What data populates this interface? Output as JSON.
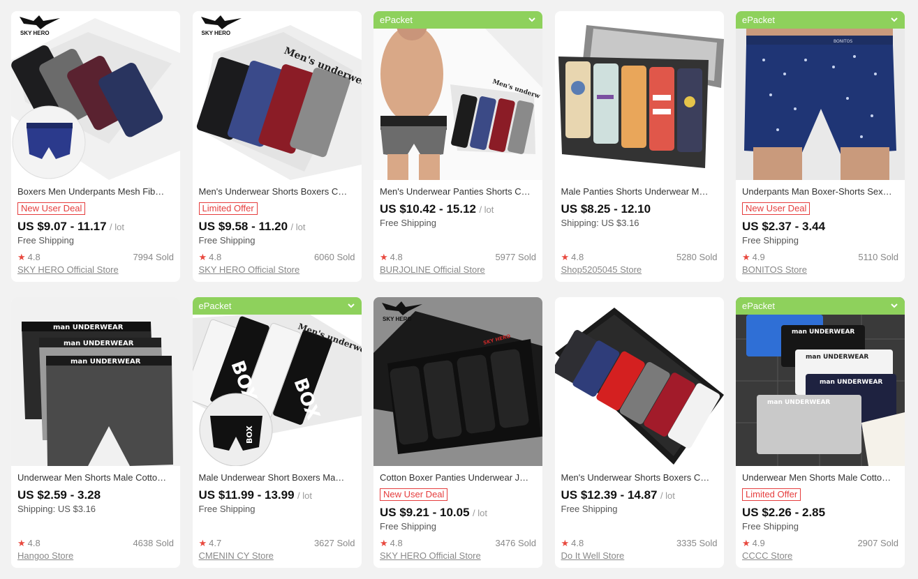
{
  "products": [
    {
      "title": "Boxers Men Underpants Mesh Fib…",
      "tag": "New User Deal",
      "price": "US $9.07 - 11.17",
      "unit": "/ lot",
      "shipping": "Free Shipping",
      "rating": "4.8",
      "sold": "7994 Sold",
      "store": "SKY HERO Official Store",
      "epacket": "",
      "brand": "SKY HERO"
    },
    {
      "title": "Men's Underwear Shorts Boxers C…",
      "tag": "Limited Offer",
      "price": "US $9.58 - 11.20",
      "unit": "/ lot",
      "shipping": "Free Shipping",
      "rating": "4.8",
      "sold": "6060 Sold",
      "store": "SKY HERO Official Store",
      "epacket": "",
      "brand": "SKY HERO"
    },
    {
      "title": "Men's Underwear Panties Shorts C…",
      "tag": "",
      "price": "US $10.42 - 15.12",
      "unit": "/ lot",
      "shipping": "Free Shipping",
      "rating": "4.8",
      "sold": "5977 Sold",
      "store": "BURJOLINE Official Store",
      "epacket": "ePacket",
      "brand": ""
    },
    {
      "title": "Male Panties Shorts Underwear M…",
      "tag": "",
      "price": "US $8.25 - 12.10",
      "unit": "",
      "shipping": "Shipping: US $3.16",
      "rating": "4.8",
      "sold": "5280 Sold",
      "store": "Shop5205045 Store",
      "epacket": "",
      "brand": ""
    },
    {
      "title": "Underpants Man Boxer-Shorts Sex…",
      "tag": "New User Deal",
      "price": "US $2.37 - 3.44",
      "unit": "",
      "shipping": "Free Shipping",
      "rating": "4.9",
      "sold": "5110 Sold",
      "store": "BONITOS Store",
      "epacket": "ePacket",
      "brand": ""
    },
    {
      "title": "Underwear Men Shorts Male Cotto…",
      "tag": "",
      "price": "US $2.59 - 3.28",
      "unit": "",
      "shipping": "Shipping: US $3.16",
      "rating": "4.8",
      "sold": "4638 Sold",
      "store": "Hangoo Store",
      "epacket": "",
      "brand": ""
    },
    {
      "title": "Male Underwear Short Boxers Ma…",
      "tag": "",
      "price": "US $11.99 - 13.99",
      "unit": "/ lot",
      "shipping": "Free Shipping",
      "rating": "4.7",
      "sold": "3627 Sold",
      "store": "CMENIN CY Store",
      "epacket": "ePacket",
      "brand": ""
    },
    {
      "title": "Cotton Boxer Panties Underwear J…",
      "tag": "New User Deal",
      "price": "US $9.21 - 10.05",
      "unit": "/ lot",
      "shipping": "Free Shipping",
      "rating": "4.8",
      "sold": "3476 Sold",
      "store": "SKY HERO Official Store",
      "epacket": "",
      "brand": "SKY HERO"
    },
    {
      "title": "Men's Underwear Shorts Boxers C…",
      "tag": "",
      "price": "US $12.39 - 14.87",
      "unit": "/ lot",
      "shipping": "Free Shipping",
      "rating": "4.8",
      "sold": "3335 Sold",
      "store": "Do It Well Store",
      "epacket": "",
      "brand": ""
    },
    {
      "title": "Underwear Men Shorts Male Cotto…",
      "tag": "Limited Offer",
      "price": "US $2.26 - 2.85",
      "unit": "",
      "shipping": "Free Shipping",
      "rating": "4.9",
      "sold": "2907 Sold",
      "store": "CCCC Store",
      "epacket": "ePacket",
      "brand": ""
    }
  ],
  "colors": {
    "tag_red": "#e53c3c",
    "star_red": "#e8493f",
    "epacket_green": "#8ed15c"
  }
}
